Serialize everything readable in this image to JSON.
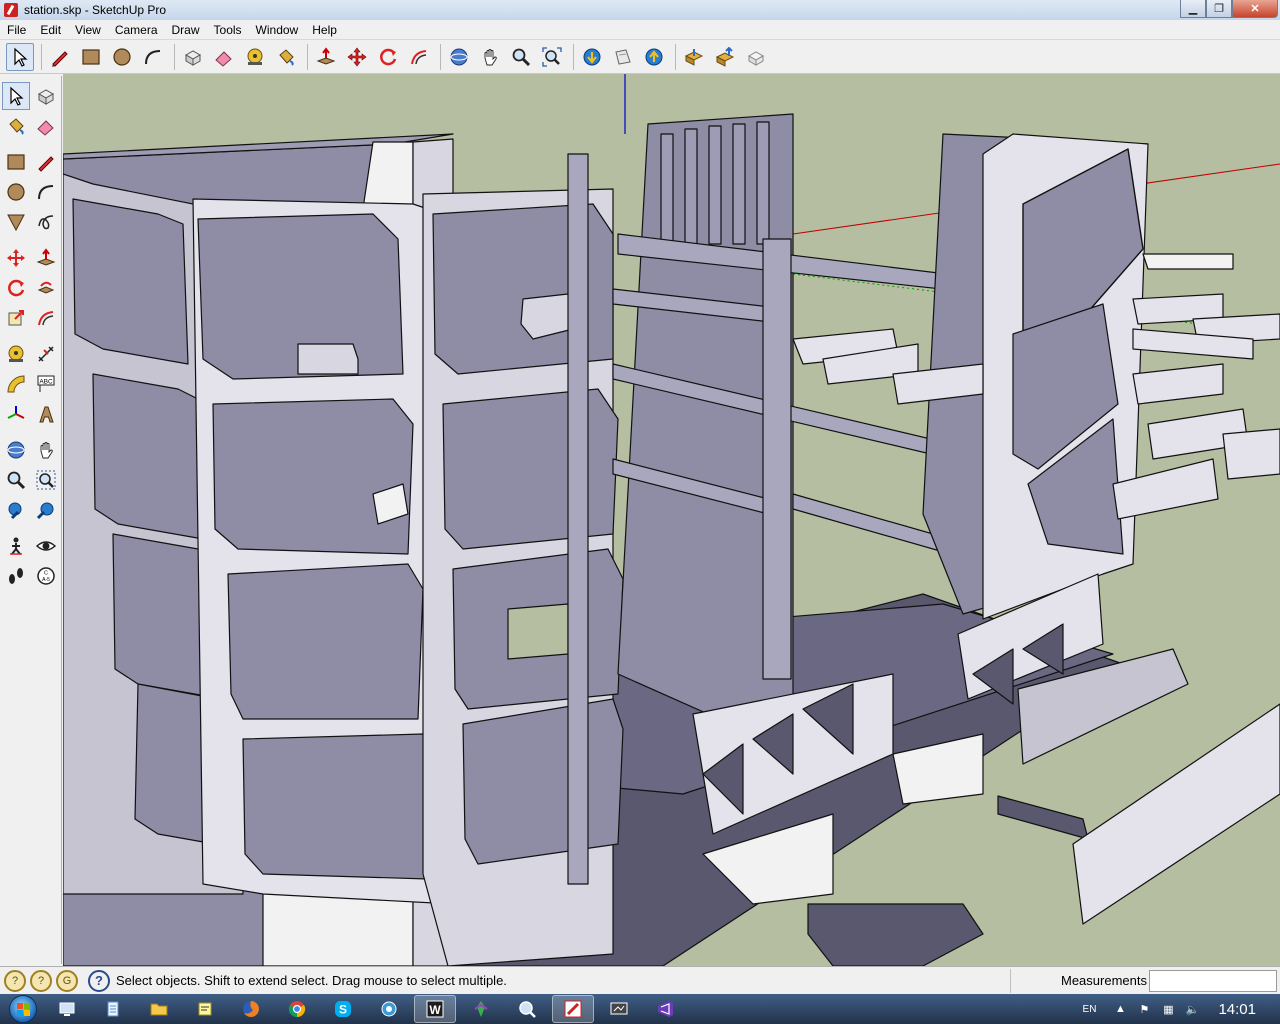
{
  "window": {
    "title": "station.skp - SketchUp Pro",
    "minimize_glyph": "▁",
    "maximize_glyph": "❐",
    "close_glyph": "✕"
  },
  "menu": {
    "file": "File",
    "edit": "Edit",
    "view": "View",
    "camera": "Camera",
    "draw": "Draw",
    "tools": "Tools",
    "window": "Window",
    "help": "Help"
  },
  "toolbar": {
    "icons": [
      "select-icon",
      "line-pencil-icon",
      "rectangle-icon",
      "circle-icon",
      "arc-icon",
      "make-component-icon",
      "eraser-icon",
      "tape-measure-icon",
      "paint-bucket-icon",
      "push-pull-icon",
      "move-icon",
      "rotate-icon",
      "offset-icon",
      "orbit-icon",
      "pan-icon",
      "zoom-icon",
      "zoom-extents-icon",
      "get-models-icon",
      "share-model-icon",
      "upload-icon",
      "get-photo-texture-icon",
      "share-component-icon",
      "preview-icon"
    ]
  },
  "status": {
    "geo_1": "?",
    "geo_2": "?",
    "geo_3": "G",
    "help_glyph": "?",
    "message": "Select objects. Shift to extend select. Drag mouse to select multiple.",
    "measurements_label": "Measurements",
    "measurements_value": ""
  },
  "taskbar": {
    "language": "EN",
    "time": "14:01",
    "apps": [
      "show-desktop",
      "notepad",
      "explorer",
      "sticky-notes",
      "firefox",
      "chrome",
      "skype",
      "network-tool",
      "word",
      "game-app",
      "search-app",
      "sketchup",
      "screen-tool",
      "visual-studio"
    ],
    "active_app": "sketchup"
  },
  "colors": {
    "viewport_ground": "#b5bea0",
    "model_face": "#8f8ca5",
    "model_light": "#d8d6e0",
    "model_white": "#f2f2f2",
    "edge": "#111111",
    "axis_red": "#c00000",
    "axis_blue": "#0000c8",
    "axis_green": "#00a000"
  }
}
